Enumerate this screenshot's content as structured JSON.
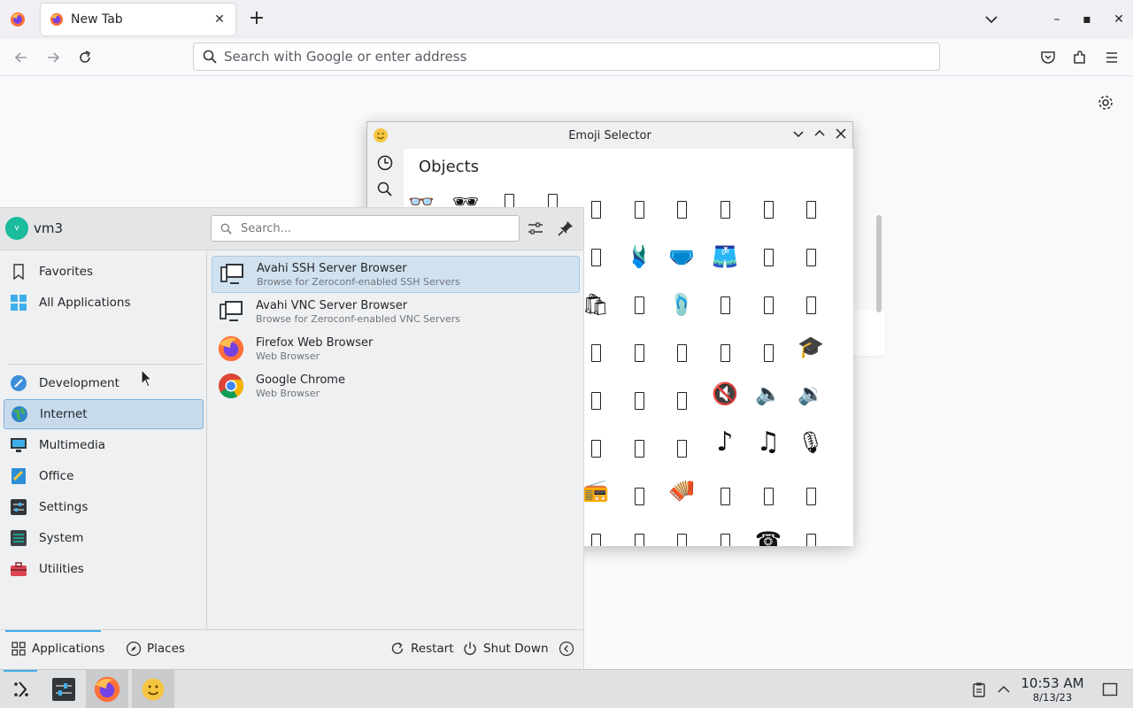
{
  "browser": {
    "tab_title": "New Tab",
    "tab_close": "✕",
    "new_tab": "+",
    "address_placeholder": "Search with Google or enter address",
    "win_minimize": "–",
    "win_maximize": "▪",
    "win_close": "✕"
  },
  "emoji_selector": {
    "title": "Emoji Selector",
    "category_title": "Objects",
    "ctrl_min": "⌄",
    "ctrl_max": "⌃",
    "ctrl_close": "✕",
    "glyphs": {
      "glasses": "👓",
      "sunglasses": "🕶",
      "swimsuit": "🩱",
      "briefs": "🩲",
      "shorts": "🩳",
      "shopping_bags": "🛍",
      "thong_sandal": "🩴",
      "graduation_cap": "🎓",
      "muted_speaker": "🔇",
      "speaker_low": "🔈",
      "speaker_high": "🔉",
      "musical_note": "♪",
      "musical_notes": "♫",
      "microphone": "🎙",
      "radio": "📻",
      "accordion": "🪗",
      "telephone": "☎"
    }
  },
  "launcher": {
    "username": "vm3",
    "avatar_initial": "v",
    "search_placeholder": "Search...",
    "categories": [
      {
        "label": "Favorites"
      },
      {
        "label": "All Applications"
      },
      {
        "label": "Development"
      },
      {
        "label": "Internet"
      },
      {
        "label": "Multimedia"
      },
      {
        "label": "Office"
      },
      {
        "label": "Settings"
      },
      {
        "label": "System"
      },
      {
        "label": "Utilities"
      }
    ],
    "apps": [
      {
        "name": "Avahi SSH Server Browser",
        "desc": "Browse for Zeroconf-enabled SSH Servers"
      },
      {
        "name": "Avahi VNC Server Browser",
        "desc": "Browse for Zeroconf-enabled VNC Servers"
      },
      {
        "name": "Firefox Web Browser",
        "desc": "Web Browser"
      },
      {
        "name": "Google Chrome",
        "desc": "Web Browser"
      }
    ],
    "footer": {
      "applications": "Applications",
      "places": "Places",
      "restart": "Restart",
      "shutdown": "Shut Down"
    }
  },
  "taskbar": {
    "time": "10:53 AM",
    "date": "8/13/23"
  },
  "colors": {
    "accent": "#3daee9",
    "selection": "#c8dbec",
    "avatar": "#1abc9c"
  }
}
